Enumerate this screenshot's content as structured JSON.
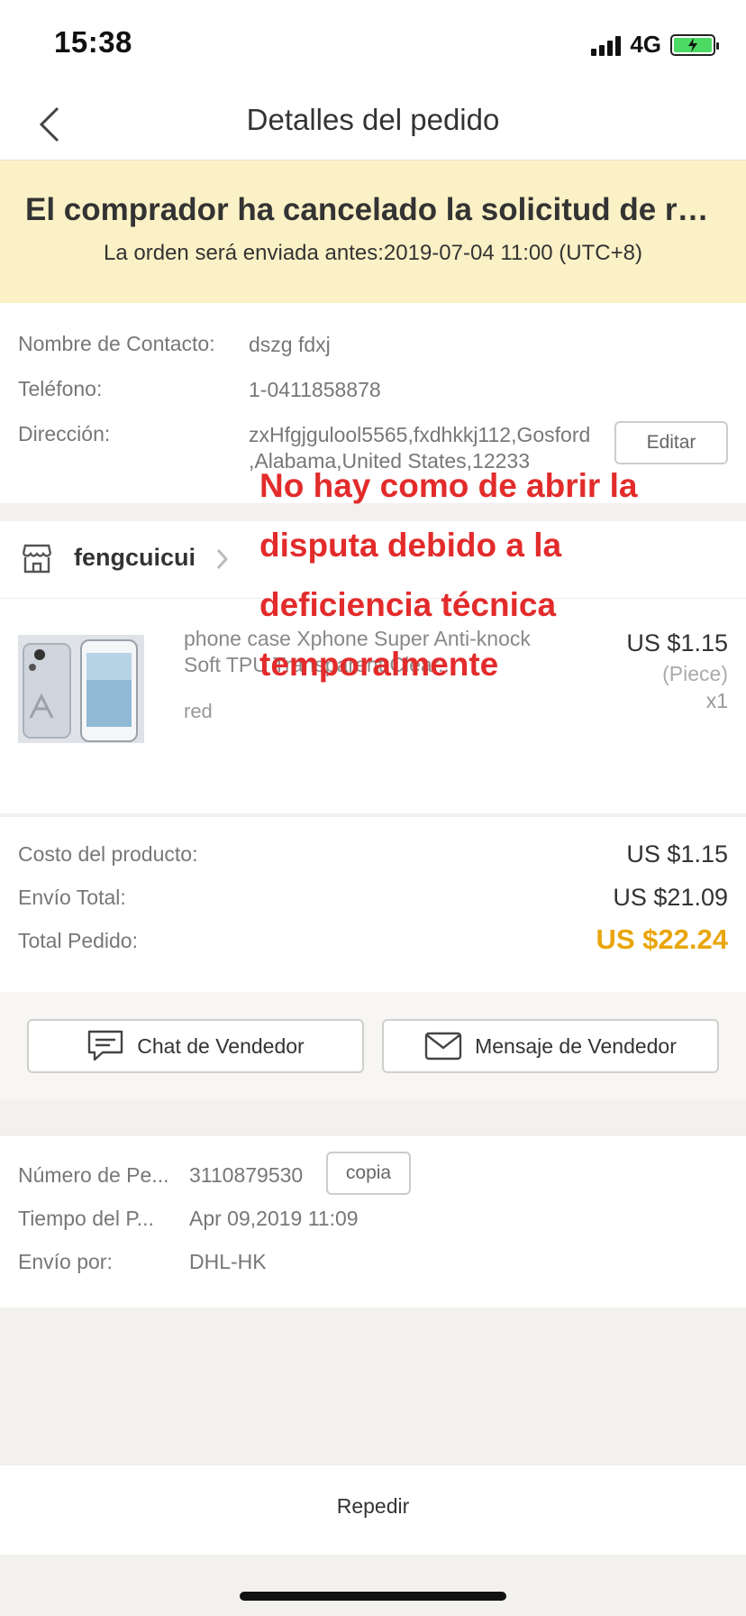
{
  "status_bar": {
    "time": "15:38",
    "network": "4G"
  },
  "nav": {
    "title": "Detalles del pedido"
  },
  "banner": {
    "title": "El comprador ha cancelado la solicitud de reembolso",
    "subtitle": "La orden será enviada antes:2019-07-04 11:00 (UTC+8)"
  },
  "contact": {
    "name_label": "Nombre de Contacto:",
    "name_value": "dszg fdxj",
    "phone_label": "Teléfono:",
    "phone_value": "1-0411858878",
    "address_label": "Dirección:",
    "address_line1": "zxHfgjgulool5565,fxdhkkj112,Gosford",
    "address_line2": ",Alabama,United States,12233",
    "edit_label": "Editar"
  },
  "store": {
    "name": "fengcuicui"
  },
  "product": {
    "title": "phone case Xphone Super Anti-knock Soft TPU Transparent Clear...",
    "color": "red",
    "price": "US $1.15",
    "unit": "(Piece)",
    "quantity": "x1"
  },
  "totals": {
    "product_cost_label": "Costo del producto:",
    "product_cost_value": "US $1.15",
    "shipping_label": "Envío Total:",
    "shipping_value": "US $21.09",
    "total_label": "Total Pedido:",
    "total_value": "US $22.24",
    "total_color": "#e8a60b"
  },
  "actions": {
    "chat_label": "Chat de Vendedor",
    "message_label": "Mensaje de Vendedor"
  },
  "order_info": {
    "number_label": "Número de Pe...",
    "number_value": "3110879530",
    "copy_label": "copia",
    "time_label": "Tiempo del P...",
    "time_value": "Apr 09,2019 11:09",
    "shipping_label": "Envío por:",
    "shipping_value": "DHL-HK"
  },
  "footer": {
    "reorder_label": "Repedir"
  },
  "overlay": {
    "line1": "No hay como de abrir la",
    "line2": "disputa debido a la",
    "line3": "deficiencia técnica",
    "line4": "temporalmente",
    "color": "#e32b2b"
  }
}
